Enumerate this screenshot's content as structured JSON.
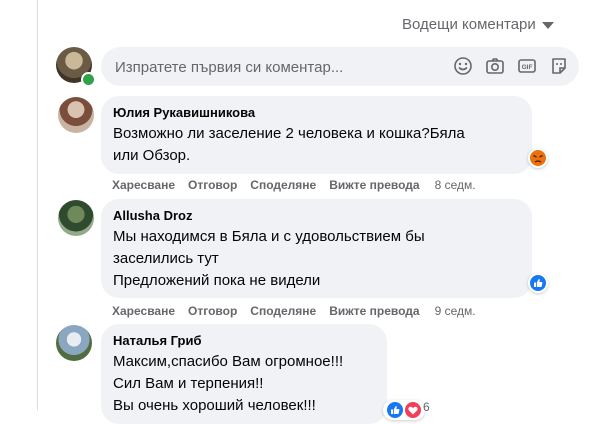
{
  "header": {
    "sort_label": "Водещи коментари"
  },
  "composer": {
    "placeholder": "Изпратете първия си коментар..."
  },
  "comments": [
    {
      "author": "Юлия Рукавишникова",
      "lines": [
        "Возможно ли заселение 2 человека и кошка?Бяла",
        "или Обзор."
      ],
      "time": "8 седм.",
      "reaction": "angry-reaction-icon"
    },
    {
      "author": "Allusha Droz",
      "lines": [
        "Мы находимся в Бяла и с удовольствием бы",
        "заселились тут",
        "Предложений пока не видели"
      ],
      "time": "9 седм.",
      "reaction": "like-reaction-icon"
    },
    {
      "author": "Наталья Гриб",
      "lines": [
        "Максим,спасибо Вам огромное!!!",
        "Сил Вам и терпения!!",
        "Вы очень хороший человек!!!"
      ],
      "reaction_count": "6"
    }
  ],
  "actions": {
    "like": "Харесване",
    "reply": "Отговор",
    "share": "Споделяне",
    "translate": "Вижте превода"
  },
  "colors": {
    "bubble": "#f0f2f5",
    "muted": "#65676b",
    "like_blue": "#1877f2",
    "angry_orange": "#e9710f",
    "love_red": "#f33e58",
    "online_green": "#31a24c"
  }
}
